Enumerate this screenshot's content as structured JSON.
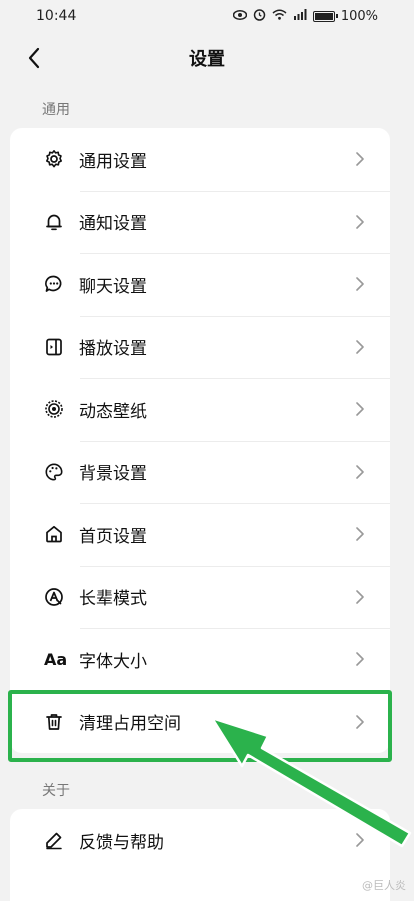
{
  "status_bar": {
    "time": "10:44",
    "battery": "100%",
    "icons": [
      "eye-icon",
      "alarm-icon",
      "wifi-icon",
      "signal-icon",
      "battery-icon"
    ]
  },
  "header": {
    "title": "设置",
    "back_icon": "chevron-left-icon"
  },
  "sections": {
    "general": {
      "label": "通用",
      "items": [
        {
          "label": "通用设置",
          "icon": "gear-icon"
        },
        {
          "label": "通知设置",
          "icon": "bell-icon"
        },
        {
          "label": "聊天设置",
          "icon": "chat-icon"
        },
        {
          "label": "播放设置",
          "icon": "play-icon"
        },
        {
          "label": "动态壁纸",
          "icon": "live-wallpaper-icon"
        },
        {
          "label": "背景设置",
          "icon": "palette-icon"
        },
        {
          "label": "首页设置",
          "icon": "home-icon"
        },
        {
          "label": "长辈模式",
          "icon": "elder-mode-icon"
        },
        {
          "label": "字体大小",
          "icon": "font-size-icon",
          "glyph": "Aa"
        },
        {
          "label": "清理占用空间",
          "icon": "trash-icon"
        }
      ]
    },
    "about": {
      "label": "关于",
      "items": [
        {
          "label": "反馈与帮助",
          "icon": "pencil-icon"
        }
      ]
    }
  },
  "watermark": "@巨人炎",
  "colors": {
    "highlight": "#2bb24c",
    "background": "#f2f2f2"
  }
}
